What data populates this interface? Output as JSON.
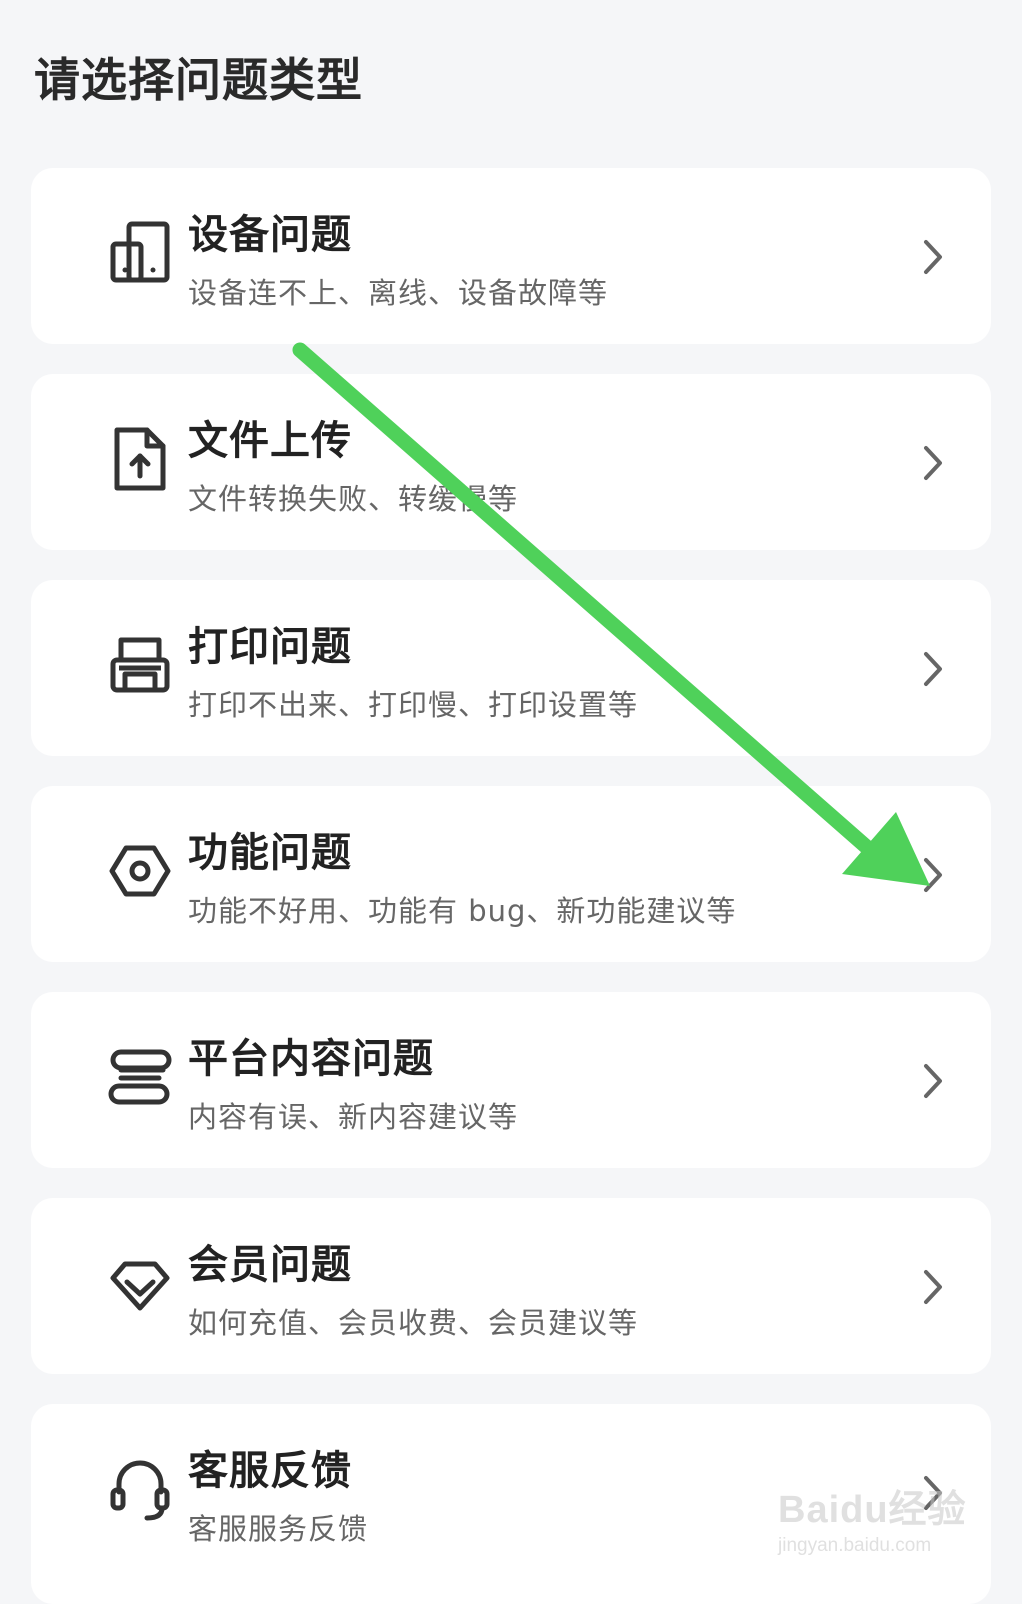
{
  "page": {
    "title": "请选择问题类型"
  },
  "categories": [
    {
      "title": "设备问题",
      "desc": "设备连不上、离线、设备故障等",
      "icon": "device-icon"
    },
    {
      "title": "文件上传",
      "desc": "文件转换失败、转缓慢等",
      "icon": "file-upload-icon"
    },
    {
      "title": "打印问题",
      "desc": "打印不出来、打印慢、打印设置等",
      "icon": "printer-icon"
    },
    {
      "title": "功能问题",
      "desc": "功能不好用、功能有 bug、新功能建议等",
      "icon": "hexagon-bolt-icon"
    },
    {
      "title": "平台内容问题",
      "desc": "内容有误、新内容建议等",
      "icon": "content-stack-icon"
    },
    {
      "title": "会员问题",
      "desc": "如何充值、会员收费、会员建议等",
      "icon": "diamond-icon"
    },
    {
      "title": "客服反馈",
      "desc": "客服服务反馈",
      "icon": "headset-icon"
    }
  ],
  "colors": {
    "background": "#f5f6f8",
    "card": "#ffffff",
    "title": "#222222",
    "description": "#666666",
    "annotation_arrow": "#4fd15a"
  },
  "watermark": {
    "text": "Baidu经验",
    "sub": "jingyan.baidu.com"
  }
}
